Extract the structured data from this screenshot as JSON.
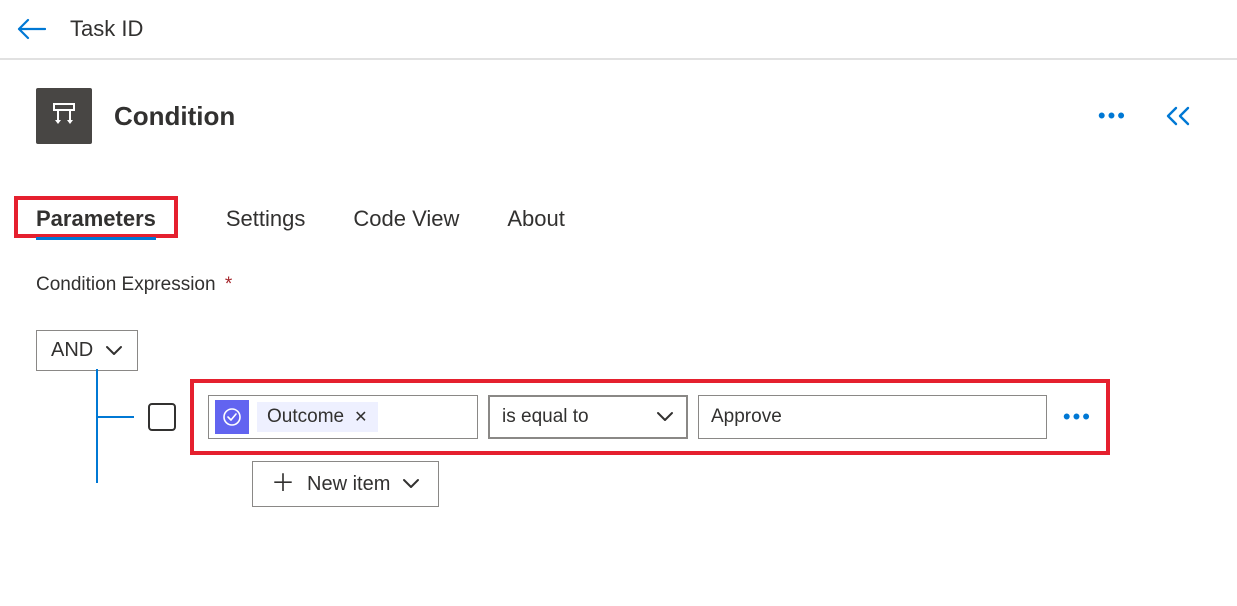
{
  "header": {
    "title": "Task ID"
  },
  "card": {
    "title": "Condition"
  },
  "tabs": {
    "items": [
      "Parameters",
      "Settings",
      "Code View",
      "About"
    ],
    "active": 0
  },
  "section": {
    "label": "Condition Expression",
    "required_mark": "*"
  },
  "expression": {
    "group_operator": "AND",
    "row": {
      "token_label": "Outcome",
      "operator": "is equal to",
      "value": "Approve"
    },
    "new_item_label": "New item"
  }
}
